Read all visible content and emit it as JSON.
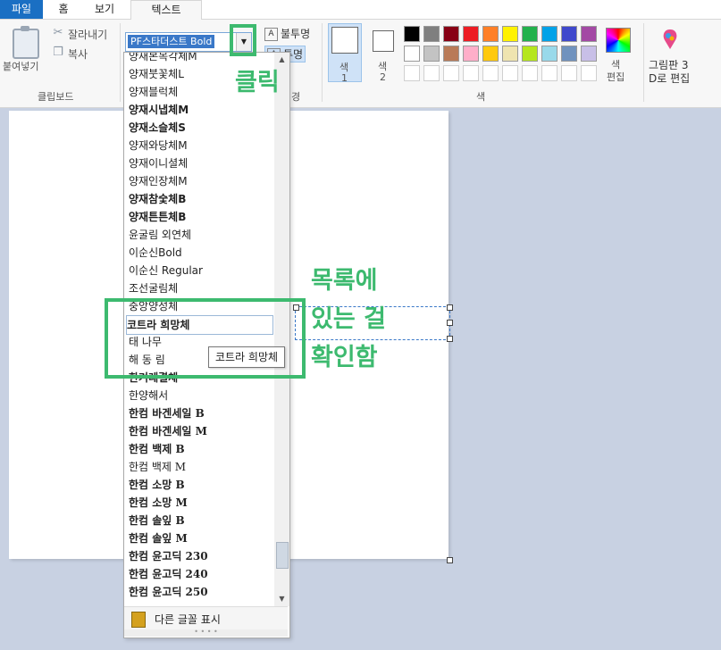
{
  "tabs": {
    "file": "파일",
    "home": "홈",
    "view": "보기",
    "text": "텍스트"
  },
  "clipboard": {
    "paste": "붙여넣기",
    "cut": "잘라내기",
    "copy": "복사",
    "group": "클립보드"
  },
  "font": {
    "current": "PF스타더스트 Bold"
  },
  "background": {
    "opaque": "불투명",
    "transparent": "투명",
    "group_partial": "경"
  },
  "colors": {
    "color1": "색",
    "color1_num": "1",
    "color2": "색",
    "color2_num": "2",
    "edit": "색",
    "edit2": "편집",
    "group": "색",
    "palette_row1": [
      "#000000",
      "#7f7f7f",
      "#880015",
      "#ed1c24",
      "#ff7f27",
      "#fff200",
      "#22b14c",
      "#00a2e8",
      "#3f48cc",
      "#a349a4"
    ],
    "palette_row2": [
      "#ffffff",
      "#c3c3c3",
      "#b97a57",
      "#ffaec9",
      "#ffc90e",
      "#efe4b0",
      "#b5e61d",
      "#99d9ea",
      "#7092be",
      "#c8bfe7"
    ]
  },
  "paint3d": {
    "line1": "그림판 3",
    "line2": "D로 편집"
  },
  "annotations": {
    "click": "클릭",
    "note_line1": "목록에",
    "note_line2": "있는 걸",
    "note_line3": "확인함"
  },
  "font_list": [
    "양재본목각체M",
    "양재붓꽃체L",
    "양재블럭체",
    "양재시냅체M",
    "양재소슬체S",
    "양재와당체M",
    "양재이니셜체",
    "양재인장체M",
    "양재참숯체B",
    "양재튼튼체B",
    "윤굴림 외연체",
    "이순신Bold",
    "이순신 Regular",
    "조선굴림체",
    "중앙양성체",
    "코트라 희망체",
    "태 나무",
    "해 동 림",
    "한겨레결체",
    "한양해서",
    "한컴 바겐세일 B",
    "한컴 바겐세일 M",
    "한컴 백제 B",
    "한컴 백제 M",
    "한컴 소망 B",
    "한컴 소망 M",
    "한컴 솔잎 B",
    "한컴 솔잎 M",
    "한컴 윤고딕 230",
    "한컴 윤고딕 240",
    "한컴 윤고딕 250"
  ],
  "more_fonts": "다른 글꼴 표시",
  "tooltip": "코트라 희망체"
}
